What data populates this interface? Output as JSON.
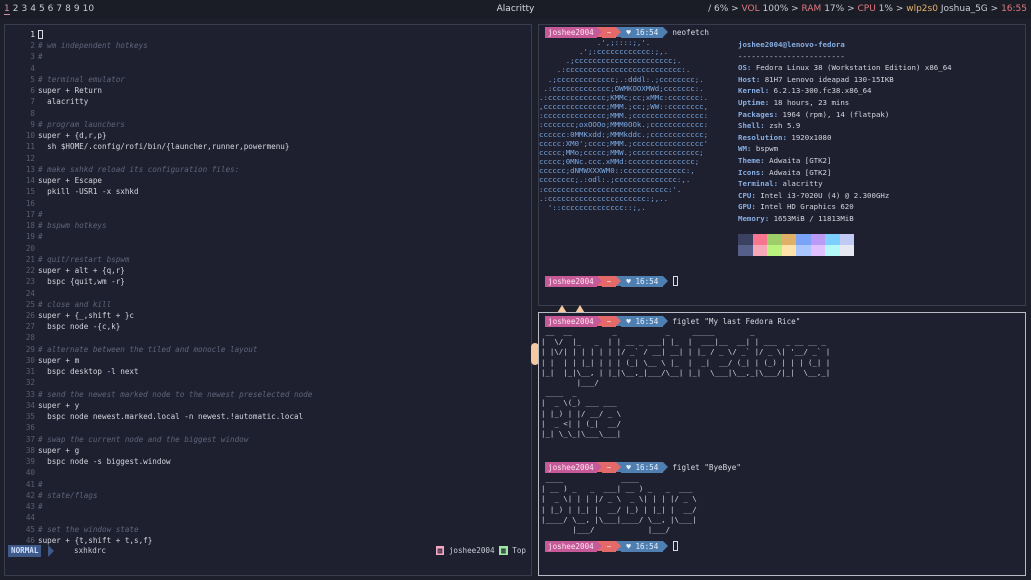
{
  "topbar": {
    "workspaces": [
      "1",
      "2",
      "3",
      "4",
      "5",
      "6",
      "7",
      "8",
      "9",
      "10"
    ],
    "active_workspace": "1",
    "window_title": "Alacritty",
    "status": {
      "sep1": "/ ",
      "disk": "6%",
      "sep2": " > ",
      "vol_label": "VOL",
      "vol": "100%",
      "sep3": " > ",
      "ram_label": "RAM",
      "ram": "17%",
      "sep4": " > ",
      "cpu_label": "CPU",
      "cpu": "1%",
      "sep5": " > ",
      "iface": "wlp2s0",
      "ssid": "Joshua_5G",
      "sep6": " > ",
      "clock": "16:55"
    }
  },
  "editor": {
    "lines": [
      {
        "n": "1",
        "text": "",
        "comment": false
      },
      {
        "n": "2",
        "text": "# wm independent hotkeys",
        "comment": true
      },
      {
        "n": "3",
        "text": "#",
        "comment": true
      },
      {
        "n": "4",
        "text": "",
        "comment": false
      },
      {
        "n": "5",
        "text": "# terminal emulator",
        "comment": true
      },
      {
        "n": "6",
        "text": "super + Return",
        "comment": false
      },
      {
        "n": "7",
        "text": "  alacritty",
        "comment": false
      },
      {
        "n": "8",
        "text": "",
        "comment": false
      },
      {
        "n": "9",
        "text": "# program launchers",
        "comment": true
      },
      {
        "n": "10",
        "text": "super + {d,r,p}",
        "comment": false
      },
      {
        "n": "11",
        "text": "  sh $HOME/.config/rofi/bin/{launcher,runner,powermenu}",
        "comment": false
      },
      {
        "n": "12",
        "text": "",
        "comment": false
      },
      {
        "n": "13",
        "text": "# make sxhkd reload its configuration files:",
        "comment": true
      },
      {
        "n": "14",
        "text": "super + Escape",
        "comment": false
      },
      {
        "n": "15",
        "text": "  pkill -USR1 -x sxhkd",
        "comment": false
      },
      {
        "n": "16",
        "text": "",
        "comment": false
      },
      {
        "n": "17",
        "text": "#",
        "comment": true
      },
      {
        "n": "18",
        "text": "# bspwm hotkeys",
        "comment": true
      },
      {
        "n": "19",
        "text": "#",
        "comment": true
      },
      {
        "n": "20",
        "text": "",
        "comment": false
      },
      {
        "n": "21",
        "text": "# quit/restart bspwm",
        "comment": true
      },
      {
        "n": "22",
        "text": "super + alt + {q,r}",
        "comment": false
      },
      {
        "n": "23",
        "text": "  bspc {quit,wm -r}",
        "comment": false
      },
      {
        "n": "24",
        "text": "",
        "comment": false
      },
      {
        "n": "25",
        "text": "# close and kill",
        "comment": true
      },
      {
        "n": "26",
        "text": "super + {_,shift + }c",
        "comment": false
      },
      {
        "n": "27",
        "text": "  bspc node -{c,k}",
        "comment": false
      },
      {
        "n": "28",
        "text": "",
        "comment": false
      },
      {
        "n": "29",
        "text": "# alternate between the tiled and monocle layout",
        "comment": true
      },
      {
        "n": "30",
        "text": "super + m",
        "comment": false
      },
      {
        "n": "31",
        "text": "  bspc desktop -l next",
        "comment": false
      },
      {
        "n": "32",
        "text": "",
        "comment": false
      },
      {
        "n": "33",
        "text": "# send the newest marked node to the newest preselected node",
        "comment": true
      },
      {
        "n": "34",
        "text": "super + y",
        "comment": false
      },
      {
        "n": "35",
        "text": "  bspc node newest.marked.local -n newest.!automatic.local",
        "comment": false
      },
      {
        "n": "36",
        "text": "",
        "comment": false
      },
      {
        "n": "37",
        "text": "# swap the current node and the biggest window",
        "comment": true
      },
      {
        "n": "38",
        "text": "super + g",
        "comment": false
      },
      {
        "n": "39",
        "text": "  bspc node -s biggest.window",
        "comment": false
      },
      {
        "n": "40",
        "text": "",
        "comment": false
      },
      {
        "n": "41",
        "text": "#",
        "comment": true
      },
      {
        "n": "42",
        "text": "# state/flags",
        "comment": true
      },
      {
        "n": "43",
        "text": "#",
        "comment": true
      },
      {
        "n": "44",
        "text": "",
        "comment": false
      },
      {
        "n": "45",
        "text": "# set the window state",
        "comment": true
      },
      {
        "n": "46",
        "text": "super + {t,shift + t,s,f}",
        "comment": false
      }
    ],
    "statusline": {
      "mode": "NORMAL",
      "filename": "sxhkdrc",
      "user": "joshee2004",
      "position": "Top"
    }
  },
  "prompt": {
    "user": "joshee2004",
    "dir": "~",
    "time": "16:54"
  },
  "neofetch": {
    "command": "neofetch",
    "logo": [
      "             .',;::::;,'.",
      "         .';:cccccccccccc:;,.",
      "      .;cccccccccccccccccccccc;.",
      "    .:cccccccccccccccccccccccccc:.",
      "  .;ccccccccccccc;.:dddl:.;cccccccc;.",
      " .:ccccccccccccc;OWMKOOXMWd;ccccccc:.",
      ".:ccccccccccccc;KMMc;cc;xMMc:ccccccc:.",
      ",cccccccccccccc;MMM.;cc;;WW::cccccccc,",
      ":cccccccccccccc;MMM.;cccccccccccccccc:",
      ":ccccccc;oxOOOo;MMM0OOk.;cccccccccccc:",
      "cccccc:0MMKxdd:;MMMkddc.;cccccccccccc;",
      "ccccc:XM0';cccc;MMM.;cccccccccccccccc'",
      "ccccc;MMo;ccccc;MMW.;ccccccccccccccc;",
      "ccccc;0MNc.ccc.xMMd:ccccccccccccccc;",
      "cccccc;dNMWXXXWM0::cccccccccccccc:,",
      "cccccccc;.:odl:.;cccccccccccccc:,.",
      ":cccccccccccccccccccccccccccc:'.",
      ".:cccccccccccccccccccccc:;,..",
      "  '::cccccccccccccc::;,."
    ],
    "host_line": "joshee2004@lenovo-fedora",
    "separator": "------------------------",
    "info": [
      {
        "k": "OS",
        "v": "Fedora Linux 38 (Workstation Edition) x86_64"
      },
      {
        "k": "Host",
        "v": "81H7 Lenovo ideapad 130-15IKB"
      },
      {
        "k": "Kernel",
        "v": "6.2.13-300.fc38.x86_64"
      },
      {
        "k": "Uptime",
        "v": "18 hours, 23 mins"
      },
      {
        "k": "Packages",
        "v": "1964 (rpm), 14 (flatpak)"
      },
      {
        "k": "Shell",
        "v": "zsh 5.9"
      },
      {
        "k": "Resolution",
        "v": "1920x1080"
      },
      {
        "k": "WM",
        "v": "bspwm"
      },
      {
        "k": "Theme",
        "v": "Adwaita [GTK2]"
      },
      {
        "k": "Icons",
        "v": "Adwaita [GTK2]"
      },
      {
        "k": "Terminal",
        "v": "alacritty"
      },
      {
        "k": "CPU",
        "v": "Intel i3-7020U (4) @ 2.300GHz"
      },
      {
        "k": "GPU",
        "v": "Intel HD Graphics 620"
      },
      {
        "k": "Memory",
        "v": "1653MiB / 11813MiB"
      }
    ],
    "palette_top": [
      "#3b4261",
      "#f7768e",
      "#9ece6a",
      "#e0af68",
      "#7aa2f7",
      "#bb9af7",
      "#7dcfff",
      "#c0caf5"
    ],
    "palette_bottom": [
      "#565f89",
      "#f7a8b8",
      "#b9f27c",
      "#ffe2a9",
      "#a9c6ff",
      "#e0c0ff",
      "#b4f9f8",
      "#e6e8f2"
    ]
  },
  "figlet1": {
    "command": "figlet \"My last Fedora Rice\"",
    "art": [
      " __  __         _           _     _____        _",
      "|  \\/  |_   _  | | __ _ ___| |_  |  ___|__  __| | ___  _ __ __ _",
      "| |\\/| | | | | | |/ _` / __| __| | |_ / _ \\/ _` |/ _ \\| '__/ _` |",
      "| |  | | |_| | | | (_| \\__ \\ |_  |  _|  __/ (_| | (_) | | | (_| |",
      "|_|  |_|\\__, | |_|\\__,_|___/\\__| |_|  \\___|\\__,_|\\___/|_|  \\__,_|",
      "        |___/",
      " ____  _",
      "|  _ \\(_) ___ ___",
      "| |_) | |/ __/ _ \\",
      "|  _ <| | (_|  __/",
      "|_| \\_\\_|\\___\\___|"
    ]
  },
  "figlet2": {
    "command": "figlet \"ByeBye\"",
    "art": [
      " ____             ____",
      "| __ ) _   _  ___| __ ) _   _  ___",
      "|  _ \\| | | |/ _ \\  _ \\| | | |/ _ \\",
      "| |_) | |_| |  __/ |_) | |_| |  __/",
      "|____/ \\__, |\\___|____/ \\__, |\\___|",
      "       |___/            |___/"
    ]
  },
  "icons": {
    "cursor": "block-cursor-icon",
    "pets": "cat-ears-icon"
  }
}
